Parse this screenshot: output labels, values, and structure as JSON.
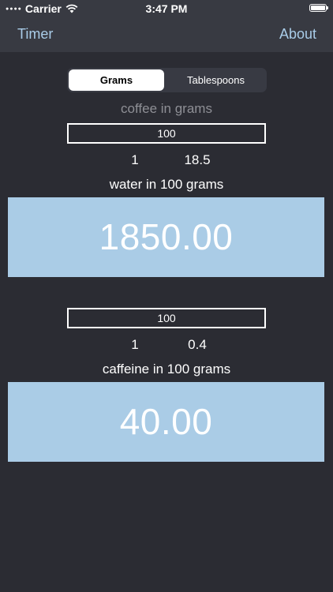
{
  "status_bar": {
    "carrier": "Carrier",
    "time": "3:47 PM"
  },
  "nav": {
    "left": "Timer",
    "right": "About"
  },
  "segmented": {
    "options": [
      "Grams",
      "Tablespoons"
    ],
    "selected": "Grams"
  },
  "coffee": {
    "label": "coffee in  grams",
    "value": "100"
  },
  "water": {
    "ratio_left": "1",
    "ratio_right": "18.5",
    "label": "water in 100 grams",
    "result": "1850.00"
  },
  "caffeine": {
    "value": "100",
    "ratio_left": "1",
    "ratio_right": "0.4",
    "label": "caffeine in 100 grams",
    "result": "40.00"
  },
  "colors": {
    "background": "#2b2c33",
    "nav_background": "#383a42",
    "accent": "#a9cce8",
    "result_background": "#aaccE6"
  }
}
